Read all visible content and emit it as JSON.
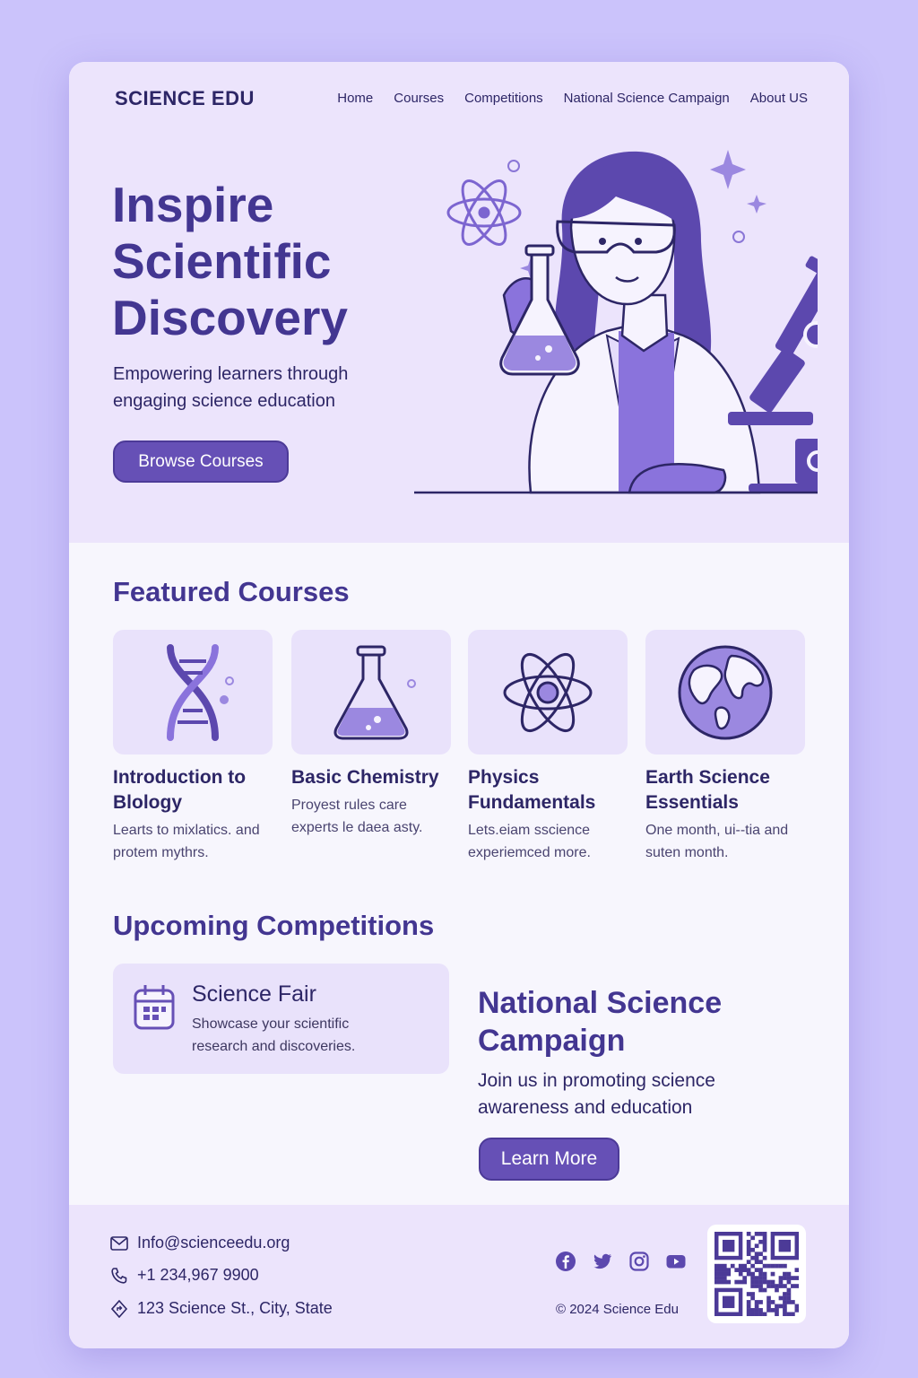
{
  "header": {
    "brand": "SCIENCE EDU",
    "nav": [
      "Home",
      "Courses",
      "Competitions",
      "National Science Campaign",
      "About US"
    ]
  },
  "hero": {
    "title": "Inspire Scientific Discovery",
    "subtitle": "Empowering learners through engaging science education",
    "button_label": "Browse Courses",
    "illustration": "scientist-with-flask-and-microscope"
  },
  "featured": {
    "title": "Featured Courses",
    "courses": [
      {
        "title": "Introduction to Blology",
        "desc": "Learts to mixlatics. and protem mythrs.",
        "icon": "dna-icon"
      },
      {
        "title": "Basic Chemistry",
        "desc": "Proyest rules care experts le daea asty.",
        "icon": "flask-icon"
      },
      {
        "title": "Physics Fundamentals",
        "desc": "Lets.eiam sscience experiemced more.",
        "icon": "atom-icon"
      },
      {
        "title": "Earth Science Essentials",
        "desc": "One month, ui--tia and suten month.",
        "icon": "globe-icon"
      }
    ]
  },
  "competitions": {
    "title": "Upcoming Competitions",
    "event": {
      "name": "Science Fair",
      "desc": "Showcase your scientific research and discoveries.",
      "icon": "calendar-icon"
    }
  },
  "campaign": {
    "title": "National Science Campaign",
    "subtitle": "Join us in promoting science awareness and education",
    "button_label": "Learn More"
  },
  "footer": {
    "email": "Info@scienceedu.org",
    "phone": "+1 234,967 9900",
    "address": "123 Science St., City, State",
    "socials": [
      "facebook-icon",
      "twitter-icon",
      "instagram-icon",
      "youtube-icon"
    ],
    "copyright": "© 2024 Science Edu"
  },
  "colors": {
    "page_bg": "#cbc3fb",
    "hero_bg": "#ece4fc",
    "accent": "#6650b6",
    "heading": "#433691",
    "text": "#2d2666"
  }
}
